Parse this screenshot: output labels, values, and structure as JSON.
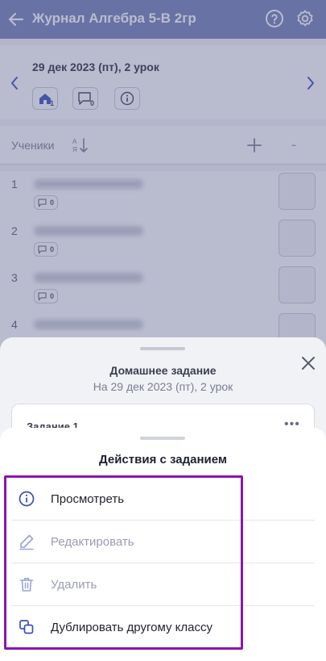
{
  "header": {
    "title": "Журнал Алгебра 5-В 2гр"
  },
  "lesson": {
    "date": "29 дек 2023 (пт), 2 урок",
    "chips": [
      {
        "icon": "homework-icon",
        "count": "1"
      },
      {
        "icon": "comment-icon",
        "count": "0"
      },
      {
        "icon": "info-icon",
        "count": ""
      }
    ]
  },
  "students": {
    "label": "Ученики",
    "rows": [
      {
        "num": "1",
        "comments": "0"
      },
      {
        "num": "2",
        "comments": "0"
      },
      {
        "num": "3",
        "comments": "0"
      },
      {
        "num": "4",
        "comments": ""
      }
    ]
  },
  "homework_sheet": {
    "title": "Домашнее задание",
    "subtitle": "На 29 дек 2023 (пт), 2 урок",
    "task_title": "Задание 1",
    "more": "•••"
  },
  "actions_sheet": {
    "title": "Действия с заданием",
    "items": [
      {
        "label": "Просмотреть",
        "icon": "info-circle-icon",
        "enabled": true
      },
      {
        "label": "Редактировать",
        "icon": "pencil-icon",
        "enabled": false
      },
      {
        "label": "Удалить",
        "icon": "trash-icon",
        "enabled": false
      },
      {
        "label": "Дублировать другому классу",
        "icon": "duplicate-icon",
        "enabled": true
      }
    ]
  },
  "colors": {
    "header": "#7480b5",
    "accent": "#3b4fb8",
    "highlight_frame": "#8a16b0",
    "disabled_text": "#9a9db0"
  }
}
